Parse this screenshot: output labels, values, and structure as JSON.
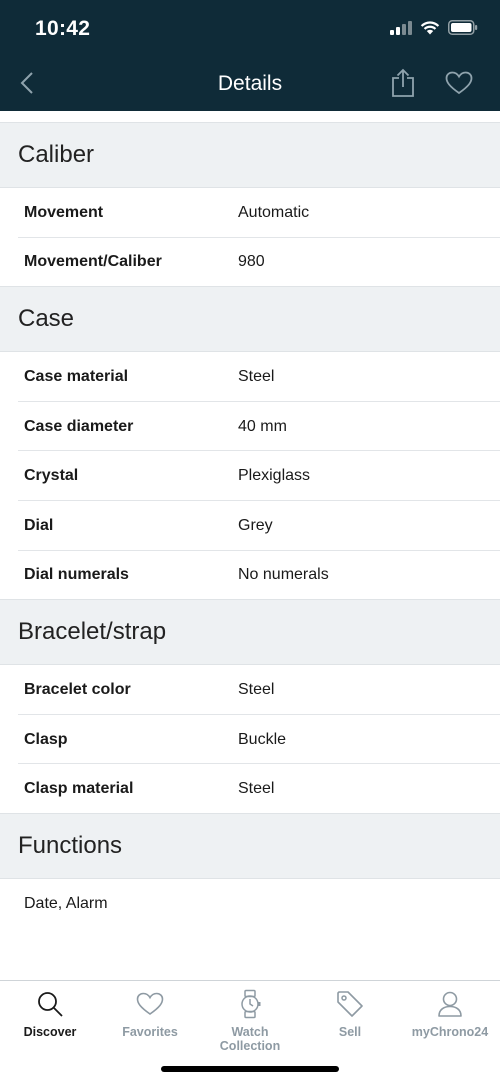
{
  "status_bar": {
    "time": "10:42"
  },
  "nav": {
    "title": "Details",
    "back_icon": "chevron-left-icon",
    "share_icon": "share-icon",
    "favorite_icon": "heart-icon"
  },
  "sections": [
    {
      "title": "Caliber",
      "rows": [
        {
          "label": "Movement",
          "value": "Automatic"
        },
        {
          "label": "Movement/Caliber",
          "value": "980"
        }
      ]
    },
    {
      "title": "Case",
      "rows": [
        {
          "label": "Case material",
          "value": "Steel"
        },
        {
          "label": "Case diameter",
          "value": "40 mm"
        },
        {
          "label": "Crystal",
          "value": "Plexiglass"
        },
        {
          "label": "Dial",
          "value": "Grey"
        },
        {
          "label": "Dial numerals",
          "value": "No numerals"
        }
      ]
    },
    {
      "title": "Bracelet/strap",
      "rows": [
        {
          "label": "Bracelet color",
          "value": "Steel"
        },
        {
          "label": "Clasp",
          "value": "Buckle"
        },
        {
          "label": "Clasp material",
          "value": "Steel"
        }
      ]
    },
    {
      "title": "Functions",
      "text": "Date, Alarm"
    }
  ],
  "tabbar": {
    "active": "Discover",
    "tabs": [
      {
        "label": "Discover",
        "icon": "search-icon"
      },
      {
        "label": "Favorites",
        "icon": "heart-icon"
      },
      {
        "label": "Watch Collection",
        "icon": "watch-icon"
      },
      {
        "label": "Sell",
        "icon": "tag-icon"
      },
      {
        "label": "myChrono24",
        "icon": "user-icon"
      }
    ]
  },
  "colors": {
    "header_bg": "#0f2b38",
    "section_bg": "#eef1f3",
    "tab_inactive": "#8e9aa3",
    "tab_active": "#1a1a1a"
  }
}
